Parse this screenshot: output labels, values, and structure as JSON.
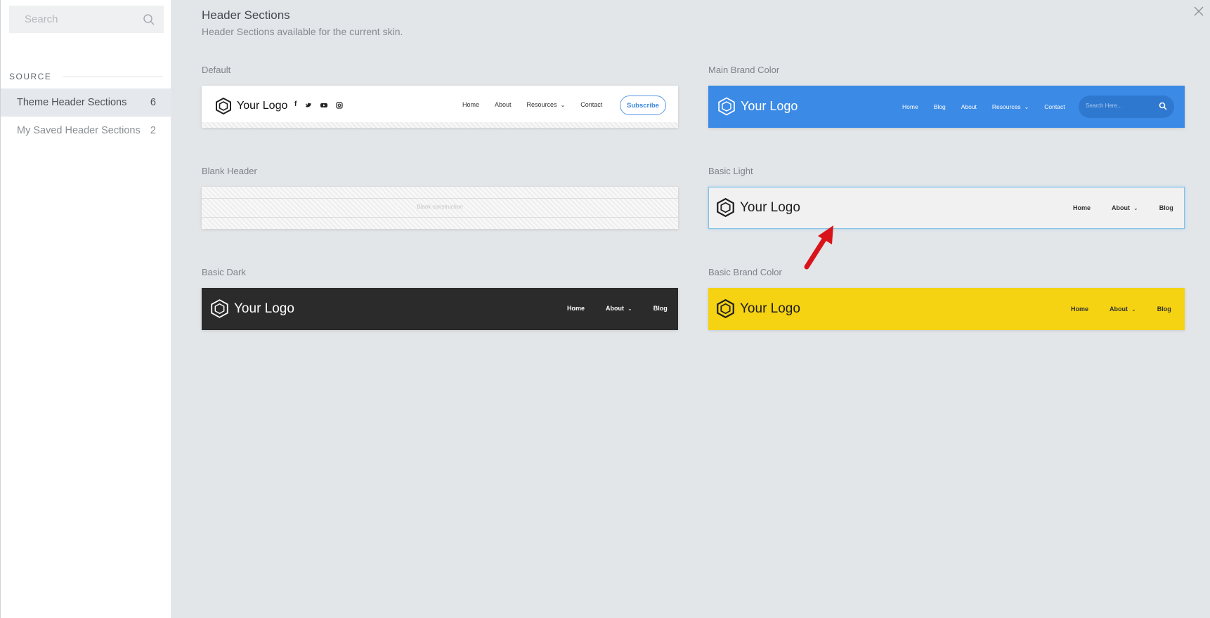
{
  "sidebar": {
    "search_placeholder": "Search",
    "source_label": "SOURCE",
    "items": [
      {
        "label": "Theme Header Sections",
        "count": "6"
      },
      {
        "label": "My Saved Header Sections",
        "count": "2"
      }
    ]
  },
  "main": {
    "title": "Header Sections",
    "subtitle": "Header Sections available for the current skin."
  },
  "colors": {
    "brand_blue": "#3b8ae6",
    "basic_brand_yellow": "#f5d312",
    "dark": "#2b2b2b",
    "selected_border": "#7ec1e8"
  },
  "cards": {
    "default": {
      "label": "Default",
      "logo": "Your Logo",
      "social_icons": [
        "f",
        "t",
        "yt",
        "ig"
      ],
      "nav": [
        "Home",
        "About",
        "Resources",
        "Contact"
      ],
      "button": "Subscribe"
    },
    "main_brand": {
      "label": "Main Brand Color",
      "logo": "Your Logo",
      "nav": [
        "Home",
        "Blog",
        "About",
        "Resources",
        "Contact"
      ],
      "search_placeholder": "Search Here..."
    },
    "blank": {
      "label": "Blank Header",
      "text": "Blank construction"
    },
    "basic_light": {
      "label": "Basic Light",
      "logo": "Your Logo",
      "nav": [
        "Home",
        "About",
        "Blog"
      ]
    },
    "basic_dark": {
      "label": "Basic Dark",
      "logo": "Your Logo",
      "nav": [
        "Home",
        "About",
        "Blog"
      ]
    },
    "basic_brand": {
      "label": "Basic Brand Color",
      "logo": "Your Logo",
      "nav": [
        "Home",
        "About",
        "Blog"
      ]
    }
  }
}
